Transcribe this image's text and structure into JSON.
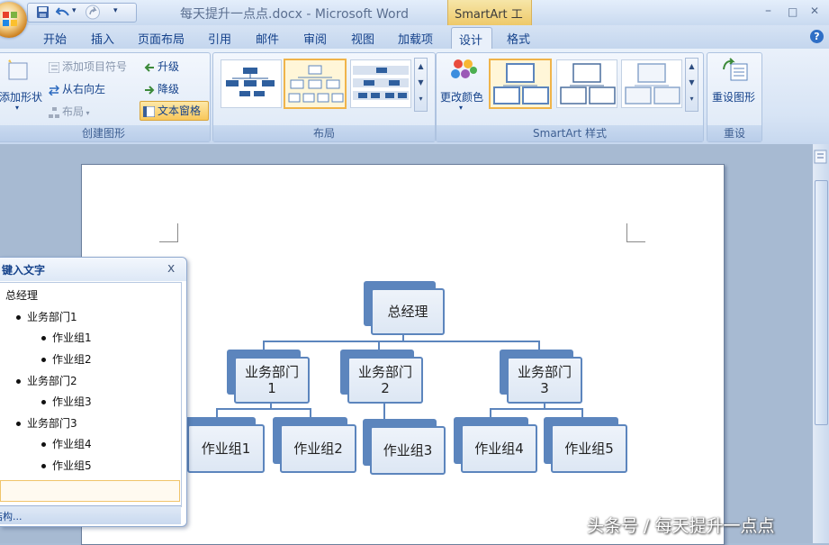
{
  "window": {
    "title": "每天提升一点点.docx - Microsoft Word",
    "context_tab": "SmartArt 工具",
    "minimize": "–",
    "maximize": "□",
    "close": "✕"
  },
  "qat": {
    "more": "▾"
  },
  "tabs": [
    "开始",
    "插入",
    "页面布局",
    "引用",
    "邮件",
    "审阅",
    "视图",
    "加载项",
    "设计",
    "格式"
  ],
  "help": "?",
  "ribbon": {
    "create_group": {
      "label": "创建图形",
      "add_shape": "添加形状",
      "add_bullet": "添加项目符号",
      "right_to_left": "从右向左",
      "layout": "布局",
      "promote": "升级",
      "demote": "降级",
      "text_pane": "文本窗格"
    },
    "layouts_group": {
      "label": "布局"
    },
    "styles_group": {
      "label": "SmartArt 样式",
      "change_colors": "更改颜色"
    },
    "reset_group": {
      "label": "重设",
      "reset_graphic": "重设图形"
    }
  },
  "text_pane": {
    "title": "键入文字",
    "close": "x",
    "items": [
      {
        "level": 0,
        "text": "总经理"
      },
      {
        "level": 1,
        "text": "业务部门1"
      },
      {
        "level": 2,
        "text": "作业组1"
      },
      {
        "level": 2,
        "text": "作业组2"
      },
      {
        "level": 1,
        "text": "业务部门2"
      },
      {
        "level": 2,
        "text": "作业组3"
      },
      {
        "level": 1,
        "text": "业务部门3"
      },
      {
        "level": 2,
        "text": "作业组4"
      },
      {
        "level": 2,
        "text": "作业组5"
      }
    ],
    "footer": "结构..."
  },
  "smartart": {
    "root": "总经理",
    "departments": [
      "业务部门\n1",
      "业务部门\n2",
      "业务部门\n3"
    ],
    "groups": [
      "作业组1",
      "作业组2",
      "作业组3",
      "作业组4",
      "作业组5"
    ]
  },
  "watermark": "头条号 / 每天提升一点点",
  "colors": {
    "accent": "#5c85bd",
    "context": "#eec96a",
    "selection": "#f0b44a"
  }
}
